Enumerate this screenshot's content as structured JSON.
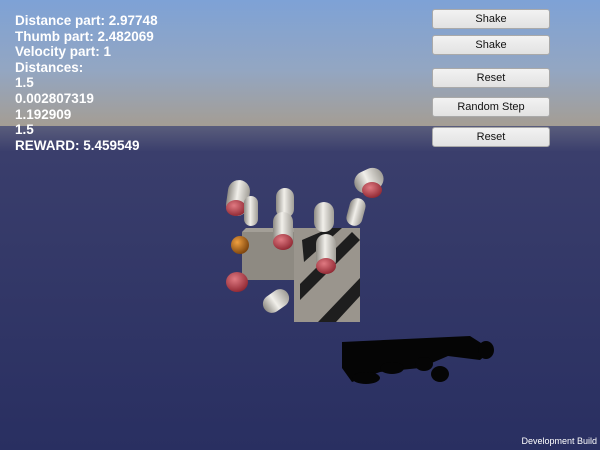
{
  "hud": {
    "lines": [
      "Distance part: 2.97748",
      "Thumb part: 2.482069",
      "Velocity part: 1",
      "Distances:",
      "1.5",
      "0.002807319",
      "1.192909",
      "1.5",
      "REWARD: 5.459549"
    ]
  },
  "buttons": {
    "shake_1": "Shake",
    "shake_2": "Shake",
    "reset_1": "Reset",
    "random_step": "Random Step",
    "reset_2": "Reset"
  },
  "footer": {
    "dev_build": "Development Build"
  },
  "colors": {
    "sky_top": "#7da0d4",
    "horizon": "#a89f92",
    "floor": "#2c3264",
    "fingertip": "#a8343c",
    "target_ball": "#c8741a",
    "finger": "#e0ddd6",
    "block": "#8f8a82"
  }
}
